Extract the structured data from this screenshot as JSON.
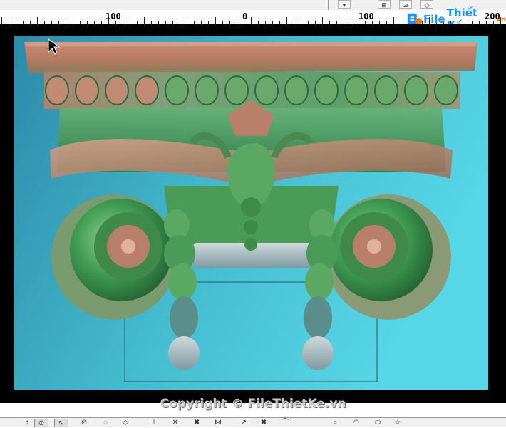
{
  "toolbar_top": {
    "icons": [
      {
        "name": "arrow-down-icon",
        "glyph": "▾"
      },
      {
        "name": "grid-tool-icon",
        "glyph": "⊞"
      },
      {
        "name": "line-tool-icon",
        "glyph": "⊿"
      },
      {
        "name": "diamond-tool-icon",
        "glyph": "◇"
      }
    ]
  },
  "ruler": {
    "labels": [
      "100",
      "0",
      "100",
      "200"
    ]
  },
  "logo": {
    "file": "File",
    "name": "Thiết Kế",
    "tld": ".vn"
  },
  "watermark": {
    "text": "Copyright © FileThietKe.vn"
  },
  "toolbar_bottom": {
    "icons": [
      {
        "name": "move-icon",
        "glyph": "↕"
      },
      {
        "name": "select-icon",
        "glyph": "⊙"
      },
      {
        "name": "pointer-icon",
        "glyph": "↖"
      },
      {
        "name": "tilt-icon",
        "glyph": "⊘"
      },
      {
        "name": "shape-icon",
        "glyph": "◌"
      },
      {
        "name": "fill-icon",
        "glyph": "◇"
      },
      {
        "name": "cursor-icon",
        "glyph": "⊥"
      },
      {
        "name": "cross-icon",
        "glyph": "✕"
      },
      {
        "name": "delete-icon",
        "glyph": "✖"
      },
      {
        "name": "node-icon",
        "glyph": "⋈"
      },
      {
        "name": "arrow-icon",
        "glyph": "↗"
      },
      {
        "name": "remove-icon",
        "glyph": "✖"
      },
      {
        "name": "curve-icon",
        "glyph": "⌒"
      },
      {
        "name": "circle-icon",
        "glyph": "○"
      },
      {
        "name": "arc-icon",
        "glyph": "◠"
      },
      {
        "name": "ellipse-icon",
        "glyph": "⬭"
      },
      {
        "name": "star-icon",
        "glyph": "☆"
      }
    ]
  },
  "colors": {
    "background_cyan": "#3fb8cc",
    "bronze": "#b8806a",
    "green": "#3f9a52"
  }
}
